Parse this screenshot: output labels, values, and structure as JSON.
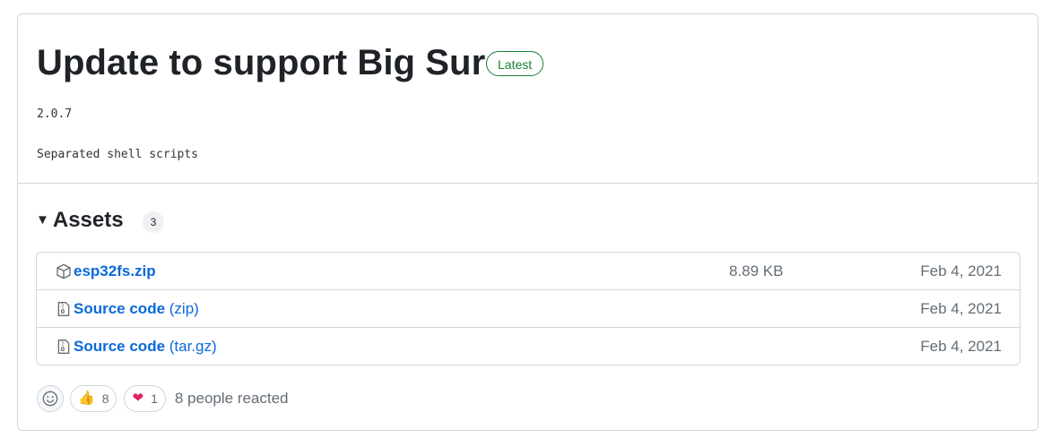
{
  "release": {
    "title": "Update to support Big Sur",
    "badge": "Latest",
    "version": "2.0.7",
    "description": "Separated shell scripts"
  },
  "assets": {
    "heading": "Assets",
    "count": "3",
    "items": [
      {
        "icon": "package-icon",
        "name": "esp32fs.zip",
        "suffix": "",
        "size": "8.89 KB",
        "date": "Feb 4, 2021"
      },
      {
        "icon": "file-zip-icon",
        "name": "Source code",
        "suffix": " (zip)",
        "size": "",
        "date": "Feb 4, 2021"
      },
      {
        "icon": "file-zip-icon",
        "name": "Source code",
        "suffix": " (tar.gz)",
        "size": "",
        "date": "Feb 4, 2021"
      }
    ]
  },
  "reactions": {
    "thumbs_up": {
      "emoji": "👍",
      "count": "8"
    },
    "heart": {
      "emoji": "❤",
      "count": "1"
    },
    "summary": "8 people reacted"
  },
  "colors": {
    "link": "#0969da",
    "badge": "#1a7f37",
    "muted": "#656d76",
    "border": "#d0d7de"
  }
}
